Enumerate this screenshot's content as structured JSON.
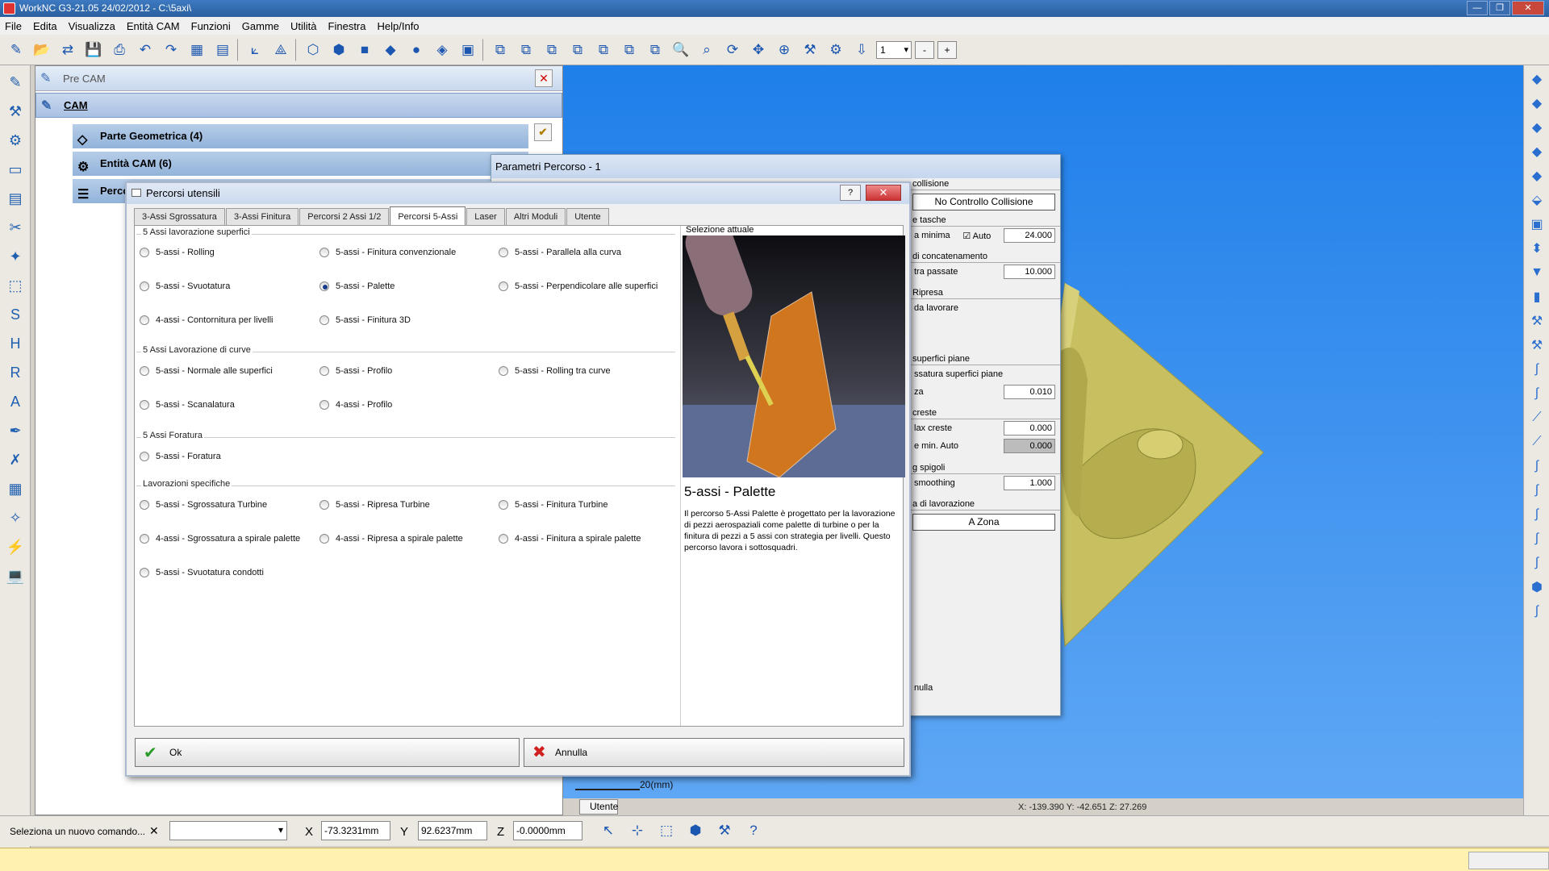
{
  "window": {
    "title": "WorkNC G3-21.05 24/02/2012 - C:\\5axi\\"
  },
  "menu": [
    "File",
    "Edita",
    "Visualizza",
    "Entità CAM",
    "Funzioni",
    "Gamme",
    "Utilità",
    "Finestra",
    "Help/Info"
  ],
  "toolbar": {
    "layer_value": "1",
    "minus": "-",
    "plus": "+"
  },
  "left_panel": {
    "precam": "Pre CAM",
    "cam": "CAM",
    "tree": [
      "Parte Geometrica (4)",
      "Entità CAM (6)",
      "Percorsi"
    ]
  },
  "param_dialog": {
    "title": "Parametri Percorso - 1",
    "groups": [
      {
        "label": "collisione",
        "button": "No Controllo Collisione"
      },
      {
        "label": "e tasche",
        "rows": [
          {
            "label": "a minima",
            "check": "Auto",
            "value": "24.000"
          }
        ]
      },
      {
        "label": "di concatenamento",
        "rows": [
          {
            "label": "tra passate",
            "value": "10.000"
          }
        ]
      },
      {
        "label": "Ripresa",
        "rows": [
          {
            "label": "da lavorare",
            "value": ""
          }
        ]
      },
      {
        "label": "superfici piane",
        "rows": [
          {
            "label": "ssatura superfici piane",
            "value": ""
          },
          {
            "label": "za",
            "value": "0.010"
          }
        ]
      },
      {
        "label": "creste",
        "rows": [
          {
            "label": "lax creste",
            "value": "0.000"
          },
          {
            "label": "e min. Auto",
            "value": "0.000"
          }
        ]
      },
      {
        "label": "g spigoli",
        "rows": [
          {
            "label": "smoothing",
            "value": "1.000"
          }
        ]
      },
      {
        "label": "a di lavorazione",
        "button": "A Zona"
      }
    ],
    "bottom": "nulla"
  },
  "perc_dialog": {
    "title": "Percorsi utensili",
    "help": "?",
    "tabs": [
      "3-Assi Sgrossatura",
      "3-Assi Finitura",
      "Percorsi 2 Assi 1/2",
      "Percorsi 5-Assi",
      "Laser",
      "Altri Moduli",
      "Utente"
    ],
    "groups": [
      {
        "label": "5 Assi lavorazione superfici",
        "items": [
          "5-assi - Rolling",
          "5-assi - Finitura convenzionale",
          "5-assi - Parallela alla curva",
          "5-assi - Svuotatura",
          "5-assi - Palette",
          "5-assi - Perpendicolare alle superfici",
          "4-assi - Contornitura per livelli",
          "5-assi - Finitura 3D"
        ]
      },
      {
        "label": "5 Assi Lavorazione di curve",
        "items": [
          "5-assi - Normale alle superfici",
          "5-assi - Profilo",
          "5-assi - Rolling tra curve",
          "5-assi - Scanalatura",
          "4-assi - Profilo"
        ]
      },
      {
        "label": "5 Assi Foratura",
        "items": [
          "5-assi - Foratura"
        ]
      },
      {
        "label": "Lavorazioni specifiche",
        "items": [
          "5-assi - Sgrossatura Turbine",
          "5-assi - Ripresa Turbine",
          "5-assi - Finitura Turbine",
          "4-assi - Sgrossatura a spirale palette",
          "4-assi - Ripresa a spirale palette",
          "4-assi - Finitura a spirale palette",
          "5-assi - Svuotatura condotti"
        ]
      }
    ],
    "selected": "5-assi - Palette",
    "selection_label": "Selezione attuale",
    "selection_title": "5-assi - Palette",
    "selection_desc": "Il percorso 5-Assi Palette è progettato per la lavorazione di pezzi aerospaziali come palette di turbine o per la finitura di pezzi a 5 assi con strategia per livelli. Questo percorso lavora i sottosquadri.",
    "ok": "Ok",
    "cancel": "Annulla"
  },
  "viewport": {
    "scale_label": "20(mm)",
    "tab": "Utente",
    "coords": "X: -139.390   Y: -42.651   Z: 27.269"
  },
  "command_bar": {
    "prompt": "Seleziona un nuovo comando...",
    "x_label": "X",
    "x_value": "-73.3231mm",
    "y_label": "Y",
    "y_value": "92.6237mm",
    "z_label": "Z",
    "z_value": "-0.0000mm"
  },
  "colors": {
    "titlebar": "#2a5f9e",
    "viewport": "#3a90f0",
    "part": "#c8c060",
    "status": "#fff2b0"
  }
}
